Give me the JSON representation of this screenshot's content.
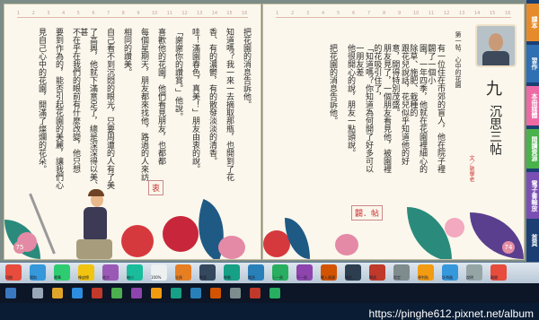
{
  "book": {
    "left_page": {
      "page_number": "75",
      "ruler_marks": [
        "1",
        "2",
        "3",
        "4",
        "5",
        "6",
        "7",
        "8",
        "9",
        "10",
        "11",
        "12",
        "13",
        "14",
        "15",
        "16"
      ],
      "columns": [
        "把花園的消息告訴他。",
        "知道嗎？我一來一去摘取那瓶，也開到了花",
        "香、有的濃鬱，有的散發淡淡的清香。",
        "哇！滿園春色，真美！」朋友由衷的說。",
        "「謝謝你的讚賞。」他說。",
        "喜歡他的花園，他們看見朋友，也都都",
        "每個星期天，朋友都來找他，路過的人來訪",
        "相同的讚美。",
        "自己看不到沉悶的眼光，只要周遭的人有了美",
        "了高興，他就下滿意足了，總是深深得以美、甚",
        "不在乎在我們的眼前有什麼改變，他只想",
        "要到作為的，能否引起花園的美麗，讓我們心",
        "見自己心中的花園，開滿了燦爛的花朵。"
      ],
      "vocab_tag": "衷"
    },
    "right_page": {
      "page_number": "74",
      "chapter_num": "九",
      "chapter_title": "沉思三帖",
      "author_tag": "文／敦學老",
      "section_title": "第一帖．心中的花園",
      "vocab_tag": "闢．帖",
      "columns": [
        "有一位住在市郊的盲人，他在院子裡闢了一個小",
        "園，一年四季，他就在花園裡細心的除草、施肥、栽種的",
        "跟花兒說話，花兒似乎知道他的好意，開得特別茂盛。",
        "朋友見了，一個朋友看見他，被園裡的花吸引住了，",
        "「知道嗎？你知道為何開了好多可以一朋友差",
        "他很開心的說，朋友一點頭說。",
        "把花園的消息告訴他。"
      ]
    }
  },
  "side_tabs": [
    "課本",
    "習作",
    "本冊媒體",
    "閱讀資源",
    "電子書輸放",
    "首頁"
  ],
  "toolbar": {
    "zoom": "100%",
    "page_range": "75/74",
    "labels": [
      "切換",
      "選取",
      "畫筆",
      "橡皮擦",
      "放大",
      "縮小",
      "100%",
      "全頁",
      "書籤",
      "移動",
      "跳頁",
      "上一頁",
      "下一頁",
      "匯入資源",
      "雙頁",
      "單頁",
      "設定",
      "便利貼",
      "計時器",
      "說明",
      "離開"
    ]
  },
  "watermark": "https://pinghe612.pixnet.net/album",
  "colors": {
    "accent_red": "#d22",
    "page_bg": "#fbf7ec",
    "tab_blue": "#1b3f73"
  }
}
